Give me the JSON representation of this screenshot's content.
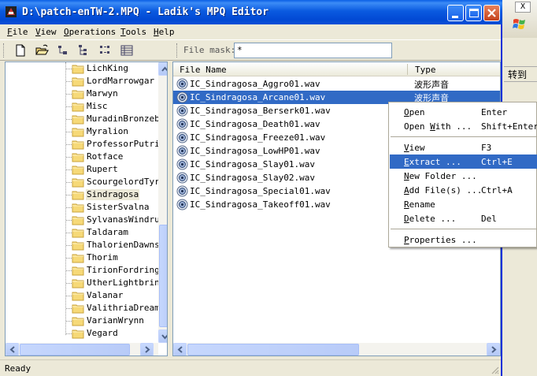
{
  "window": {
    "title": "D:\\patch-enTW-2.MPQ - Ladik's MPQ Editor"
  },
  "menubar": {
    "items": [
      {
        "first": "F",
        "rest": "ile"
      },
      {
        "first": "V",
        "rest": "iew"
      },
      {
        "first": "O",
        "rest": "perations"
      },
      {
        "first": "T",
        "rest": "ools"
      },
      {
        "first": "H",
        "rest": "elp"
      }
    ]
  },
  "toolbar": {
    "icons": [
      "new-file-icon",
      "open-folder-icon",
      "tree-view-icon",
      "tree-expand-icon",
      "list-view-icon",
      "details-view-icon"
    ],
    "file_mask_label": "File mask:",
    "file_mask_value": "*"
  },
  "tree": {
    "items": [
      "LichKing",
      "LordMarrowgar",
      "Marwyn",
      "Misc",
      "MuradinBronzebe",
      "Myralion",
      "ProfessorPutric",
      "Rotface",
      "Rupert",
      "ScourgelordTyra",
      "Sindragosa",
      "SisterSvalna",
      "SylvanasWindrun",
      "Taldaram",
      "ThalorienDawnse",
      "Thorim",
      "TirionFordring",
      "UtherLightbring",
      "Valanar",
      "ValithriaDreamw",
      "VarianWrynn",
      "Vegard"
    ],
    "selected": "Sindragosa"
  },
  "file_list": {
    "columns": [
      "File Name",
      "Type"
    ],
    "rows": [
      {
        "name": "IC_Sindragosa_Aggro01.wav",
        "type": "波形声音"
      },
      {
        "name": "IC_Sindragosa_Arcane01.wav",
        "type": "波形声音",
        "selected": true
      },
      {
        "name": "IC_Sindragosa_Berserk01.wav",
        "type": ""
      },
      {
        "name": "IC_Sindragosa_Death01.wav",
        "type": ""
      },
      {
        "name": "IC_Sindragosa_Freeze01.wav",
        "type": ""
      },
      {
        "name": "IC_Sindragosa_LowHP01.wav",
        "type": ""
      },
      {
        "name": "IC_Sindragosa_Slay01.wav",
        "type": ""
      },
      {
        "name": "IC_Sindragosa_Slay02.wav",
        "type": ""
      },
      {
        "name": "IC_Sindragosa_Special01.wav",
        "type": ""
      },
      {
        "name": "IC_Sindragosa_Takeoff01.wav",
        "type": ""
      }
    ]
  },
  "context_menu": {
    "items": [
      {
        "pre": "",
        "u": "O",
        "post": "pen",
        "shortcut": "Enter"
      },
      {
        "pre": "Open ",
        "u": "W",
        "post": "ith ...",
        "shortcut": "Shift+Enter"
      },
      {
        "pre": "",
        "u": "V",
        "post": "iew",
        "shortcut": "F3"
      },
      {
        "pre": "",
        "u": "E",
        "post": "xtract ...",
        "shortcut": "Ctrl+E",
        "highlighted": true
      },
      {
        "pre": "",
        "u": "N",
        "post": "ew Folder ...",
        "shortcut": ""
      },
      {
        "pre": "",
        "u": "A",
        "post": "dd File(s) ...",
        "shortcut": "Ctrl+A"
      },
      {
        "pre": "",
        "u": "R",
        "post": "ename",
        "shortcut": ""
      },
      {
        "pre": "",
        "u": "D",
        "post": "elete ...",
        "shortcut": "Del"
      },
      {
        "pre": "",
        "u": "P",
        "post": "roperties ...",
        "shortcut": ""
      }
    ]
  },
  "statusbar": {
    "text": "Ready"
  },
  "background_window": {
    "close_label": "X",
    "go_label": "转到"
  },
  "colors": {
    "title_blue": "#0a5ae0",
    "selection_blue": "#316ac5",
    "window_bg": "#ece9d8",
    "folder_yellow": "#f6d978"
  }
}
